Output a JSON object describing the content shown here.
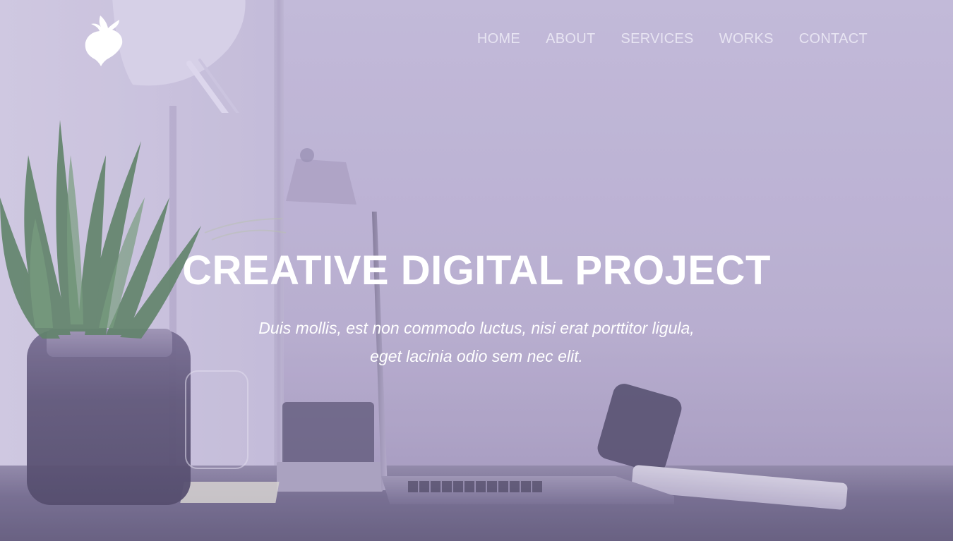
{
  "site": {
    "logo_icon": "beet-icon"
  },
  "nav": {
    "items": [
      {
        "label": "HOME"
      },
      {
        "label": "ABOUT"
      },
      {
        "label": "SERVICES"
      },
      {
        "label": "WORKS"
      },
      {
        "label": "CONTACT"
      }
    ]
  },
  "hero": {
    "title": "CREATIVE DIGITAL PROJECT",
    "subtitle": "Duis mollis, est non commodo luctus, nisi erat porttitor ligula, eget lacinia odio sem nec elit."
  },
  "colors": {
    "overlay": "#bdb4d3",
    "text": "#ffffff",
    "nav_text": "#ece9f5"
  }
}
